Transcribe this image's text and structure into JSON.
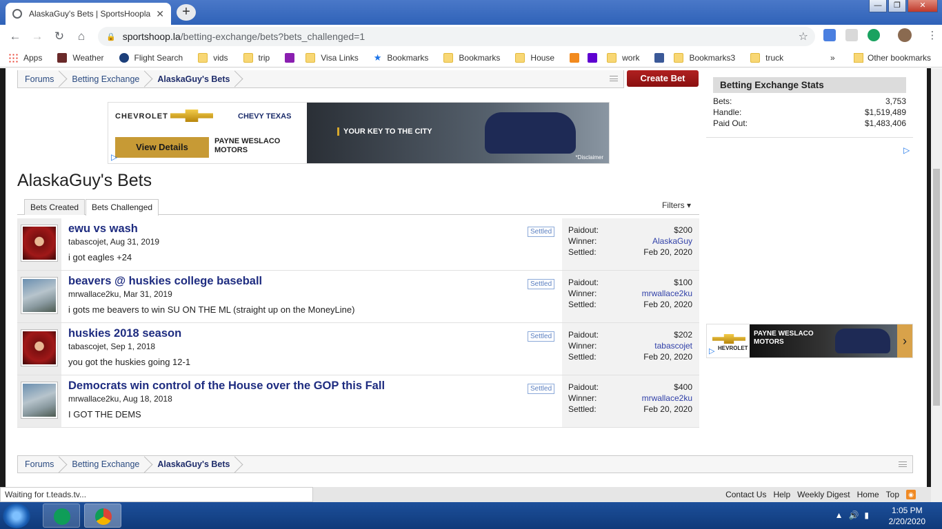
{
  "browser": {
    "tab_title": "AlaskaGuy's Bets | SportsHoopla",
    "tab_close": "✕",
    "new_tab": "+",
    "url_host": "sportshoop.la",
    "url_path": "/betting-exchange/bets?bets_challenged=1",
    "window_buttons": [
      "—",
      "❐",
      "✕"
    ]
  },
  "bookmarks": [
    {
      "label": "Apps",
      "icon": "apps-grid-icon"
    },
    {
      "label": "Weather",
      "icon": "weather-icon"
    },
    {
      "label": "Flight Search",
      "icon": "flight-icon"
    },
    {
      "label": "vids",
      "icon": "folder-icon"
    },
    {
      "label": "trip",
      "icon": "folder-icon"
    },
    {
      "label": "",
      "icon": "paypal-icon"
    },
    {
      "label": "Visa Links",
      "icon": "folder-icon"
    },
    {
      "label": "Bookmarks",
      "icon": "star-icon"
    },
    {
      "label": "Bookmarks",
      "icon": "folder-icon"
    },
    {
      "label": "House",
      "icon": "folder-icon"
    },
    {
      "label": "",
      "icon": "odnoklassniki-icon"
    },
    {
      "label": "",
      "icon": "yahoo-icon"
    },
    {
      "label": "work",
      "icon": "folder-icon"
    },
    {
      "label": "",
      "icon": "facebook-icon"
    },
    {
      "label": "Bookmarks3",
      "icon": "folder-icon"
    },
    {
      "label": "truck",
      "icon": "folder-icon"
    }
  ],
  "bookmarks_overflow": "»",
  "other_bookmarks": "Other bookmarks",
  "breadcrumb": [
    "Forums",
    "Betting Exchange",
    "AlaskaGuy's Bets"
  ],
  "create_bet": "Create Bet",
  "ad_banner": {
    "brand": "CHEVROLET",
    "texas": "CHEVY TEXAS",
    "cta": "View Details",
    "dealer_line1": "PAYNE WESLACO",
    "dealer_line2": "MOTORS",
    "tagline": "YOUR KEY TO THE CITY",
    "disclaimer": "*Disclaimer"
  },
  "page_title": "AlaskaGuy's Bets",
  "tabs": [
    {
      "label": "Bets Created",
      "active": false
    },
    {
      "label": "Bets Challenged",
      "active": true
    }
  ],
  "filters": "Filters ▾",
  "bets": [
    {
      "title": "ewu vs wash",
      "meta": "tabascojet, Aug 31, 2019",
      "desc": "i got eagles +24",
      "badge": "Settled",
      "avatar": "red",
      "paidout": "$200",
      "winner": "AlaskaGuy",
      "settled": "Feb 20, 2020"
    },
    {
      "title": "beavers @ huskies college baseball",
      "meta": "mrwallace2ku, Mar 31, 2019",
      "desc": "i gots me beavers to win SU ON THE ML (straight up on the MoneyLine)",
      "badge": "Settled",
      "avatar": "fish",
      "paidout": "$100",
      "winner": "mrwallace2ku",
      "settled": "Feb 20, 2020"
    },
    {
      "title": "huskies 2018 season",
      "meta": "tabascojet, Sep 1, 2018",
      "desc": "you got the huskies going 12-1",
      "badge": "Settled",
      "avatar": "red",
      "paidout": "$202",
      "winner": "tabascojet",
      "settled": "Feb 20, 2020"
    },
    {
      "title": "Democrats win control of the House over the GOP this Fall",
      "meta": "mrwallace2ku, Aug 18, 2018",
      "desc": "I GOT THE DEMS",
      "badge": "Settled",
      "avatar": "fish",
      "paidout": "$400",
      "winner": "mrwallace2ku",
      "settled": "Feb 20, 2020"
    }
  ],
  "stat_labels": {
    "paidout": "Paidout:",
    "winner": "Winner:",
    "settled": "Settled:"
  },
  "sidebar": {
    "title": "Betting Exchange Stats",
    "rows": [
      {
        "label": "Bets:",
        "value": "3,753"
      },
      {
        "label": "Handle:",
        "value": "$1,519,489"
      },
      {
        "label": "Paid Out:",
        "value": "$1,483,406"
      }
    ]
  },
  "side_ad": {
    "dealer_line1": "PAYNE WESLACO",
    "dealer_line2": "MOTORS",
    "brand": "HEVROLET",
    "arrow": "›"
  },
  "status_text": "Waiting for t.teads.tv...",
  "footer_links": [
    "Contact Us",
    "Help",
    "Weekly Digest",
    "Home",
    "Top"
  ],
  "clock": {
    "time": "1:05 PM",
    "date": "2/20/2020"
  }
}
